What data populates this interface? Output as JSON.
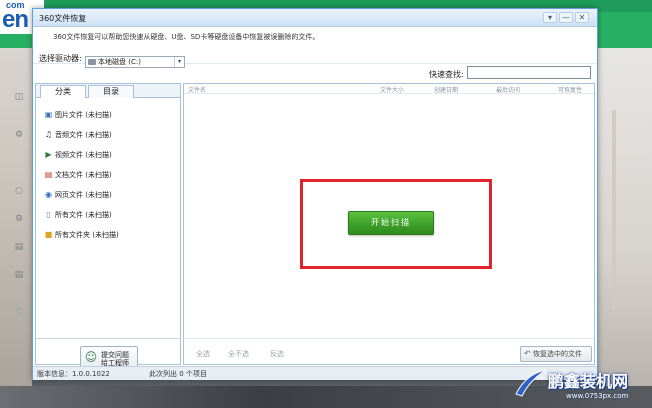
{
  "logo": {
    "top": "com",
    "big": "en"
  },
  "window": {
    "title": "360文件恢复",
    "controls": {
      "menu": "▾",
      "minimize": "—",
      "close": "✕"
    }
  },
  "description": "360文件恢复可以帮助您快速从硬盘、U盘、SD卡等硬盘设备中恢复被误删除的文件。",
  "drive": {
    "label": "选择驱动器:",
    "selected": "本地磁盘 (C:)"
  },
  "search": {
    "label": "快速查找:",
    "value": ""
  },
  "left_tabs": [
    {
      "label": "分类"
    },
    {
      "label": "目录"
    }
  ],
  "categories": [
    {
      "label": "图片文件 (未扫描)",
      "icon": "image-icon"
    },
    {
      "label": "音频文件 (未扫描)",
      "icon": "music-icon"
    },
    {
      "label": "视频文件 (未扫描)",
      "icon": "video-icon"
    },
    {
      "label": "文档文件 (未扫描)",
      "icon": "document-icon"
    },
    {
      "label": "网页文件 (未扫描)",
      "icon": "web-icon"
    },
    {
      "label": "所有文件 (未扫描)",
      "icon": "file-icon"
    },
    {
      "label": "所有文件夹 (未扫描)",
      "icon": "folder-icon"
    }
  ],
  "feedback": {
    "line1": "提交问题",
    "line2": "给工程师"
  },
  "columns": [
    "文件名",
    "文件大小",
    "创建日期",
    "最后访问",
    "可恢复性"
  ],
  "start_button": "开始扫描",
  "actions": {
    "select_all": "全选",
    "select_none": "全不选",
    "invert": "反选",
    "restore": "恢复选中的文件"
  },
  "status": {
    "version": "版本信息：1.0.0.1022",
    "scan_info": "此次列出 0 个项目"
  },
  "watermark": {
    "main": "鹏鑫装机网",
    "url": "www.0753px.com"
  },
  "colors": {
    "accent_green": "#3da12a",
    "highlight_red": "#e3232b",
    "border_blue": "#a9c2dc"
  }
}
